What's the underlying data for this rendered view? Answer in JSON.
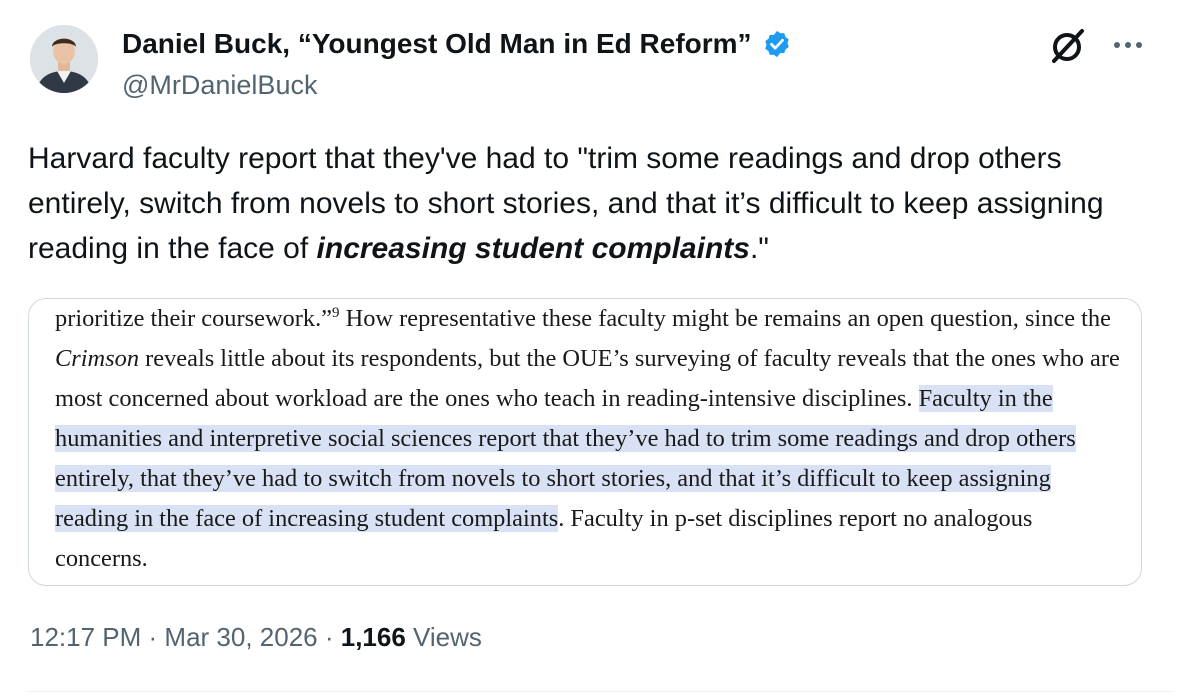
{
  "author": {
    "display_name": "Daniel Buck, “Youngest Old Man in Ed Reform”",
    "handle": "@MrDanielBuck",
    "verified": true,
    "verified_color": "#1d9bf0",
    "avatar_icon": "avatar-photo"
  },
  "header_icons": {
    "grok": "grok-icon",
    "more": "more-icon"
  },
  "tweet": {
    "text_before": "Harvard faculty report that they've had to \"trim some readings and drop others entirely, switch from novels to short stories, and that it’s difficult to keep assigning reading in the face of ",
    "text_emphasis": "increasing student complaints",
    "text_after": ".\""
  },
  "excerpt": {
    "p1": "prioritize their coursework.”",
    "footnote": "9",
    "p2": " How representative these faculty might be remains an open question, since the ",
    "crimson": "Crimson",
    "p3": " reveals little about its respondents, but the OUE’s surveying of faculty reveals that the ones who are most concerned about workload are the ones who teach in reading-intensive disciplines. ",
    "highlight": "Faculty in the humanities and interpretive social sciences report that they’ve had to trim some readings and drop others entirely, that they’ve had to switch from novels to short stories, and that it’s difficult to keep assigning reading in the face of increasing student complaints",
    "p4": ". Faculty in p-set disciplines report no analogous concerns.",
    "highlight_color": "#d9e2f5"
  },
  "meta": {
    "time": "12:17 PM",
    "sep1": " · ",
    "date": "Mar 30, 2026",
    "sep2": " · ",
    "views_count": "1,166",
    "views_label": " Views"
  }
}
